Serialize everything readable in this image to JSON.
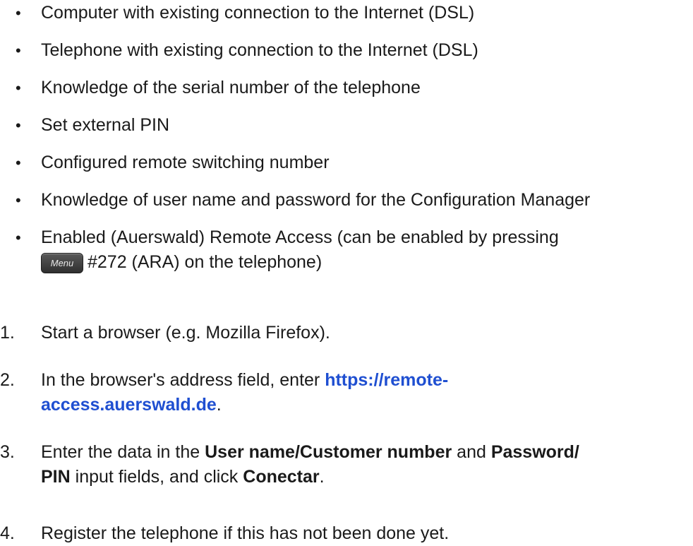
{
  "requirements": [
    "Computer with existing connection to the Internet (DSL)",
    "Telephone with existing connection to the Internet (DSL)",
    "Knowledge of the serial number of the telephone",
    "Set external PIN",
    "Configured remote switching number",
    "Knowledge of user name and password for the Configuration Manager"
  ],
  "remote_access_item": {
    "text_before_key": "Enabled (Auerswald) Remote Access (can be enabled by pressing",
    "menu_key_label": "Menu",
    "text_after_key": "#272 (ARA) on the telephone)"
  },
  "bullet_symbol": "•",
  "steps": {
    "s1": {
      "number": "1.",
      "text": "Start a browser (e.g. Mozilla Firefox)."
    },
    "s2": {
      "number": "2.",
      "text_before": "In the browser's address field, enter ",
      "link_line1": "https://remote-",
      "link_line2": "access.auerswald.de",
      "text_after": "."
    },
    "s3": {
      "number": "3.",
      "part1": "Enter the data in the ",
      "bold1": "User name/Customer number",
      "part2": " and ",
      "bold2": "Password/",
      "bold3": "PIN",
      "part3": " input fields, and click ",
      "bold4": "Conectar",
      "part4": "."
    },
    "s4": {
      "number": "4.",
      "text": "Register the telephone if this has not been done yet."
    }
  },
  "colors": {
    "text": "#1a1a1a",
    "link": "#1f4fd1",
    "menu_key_bg": "#3f3f3f"
  }
}
